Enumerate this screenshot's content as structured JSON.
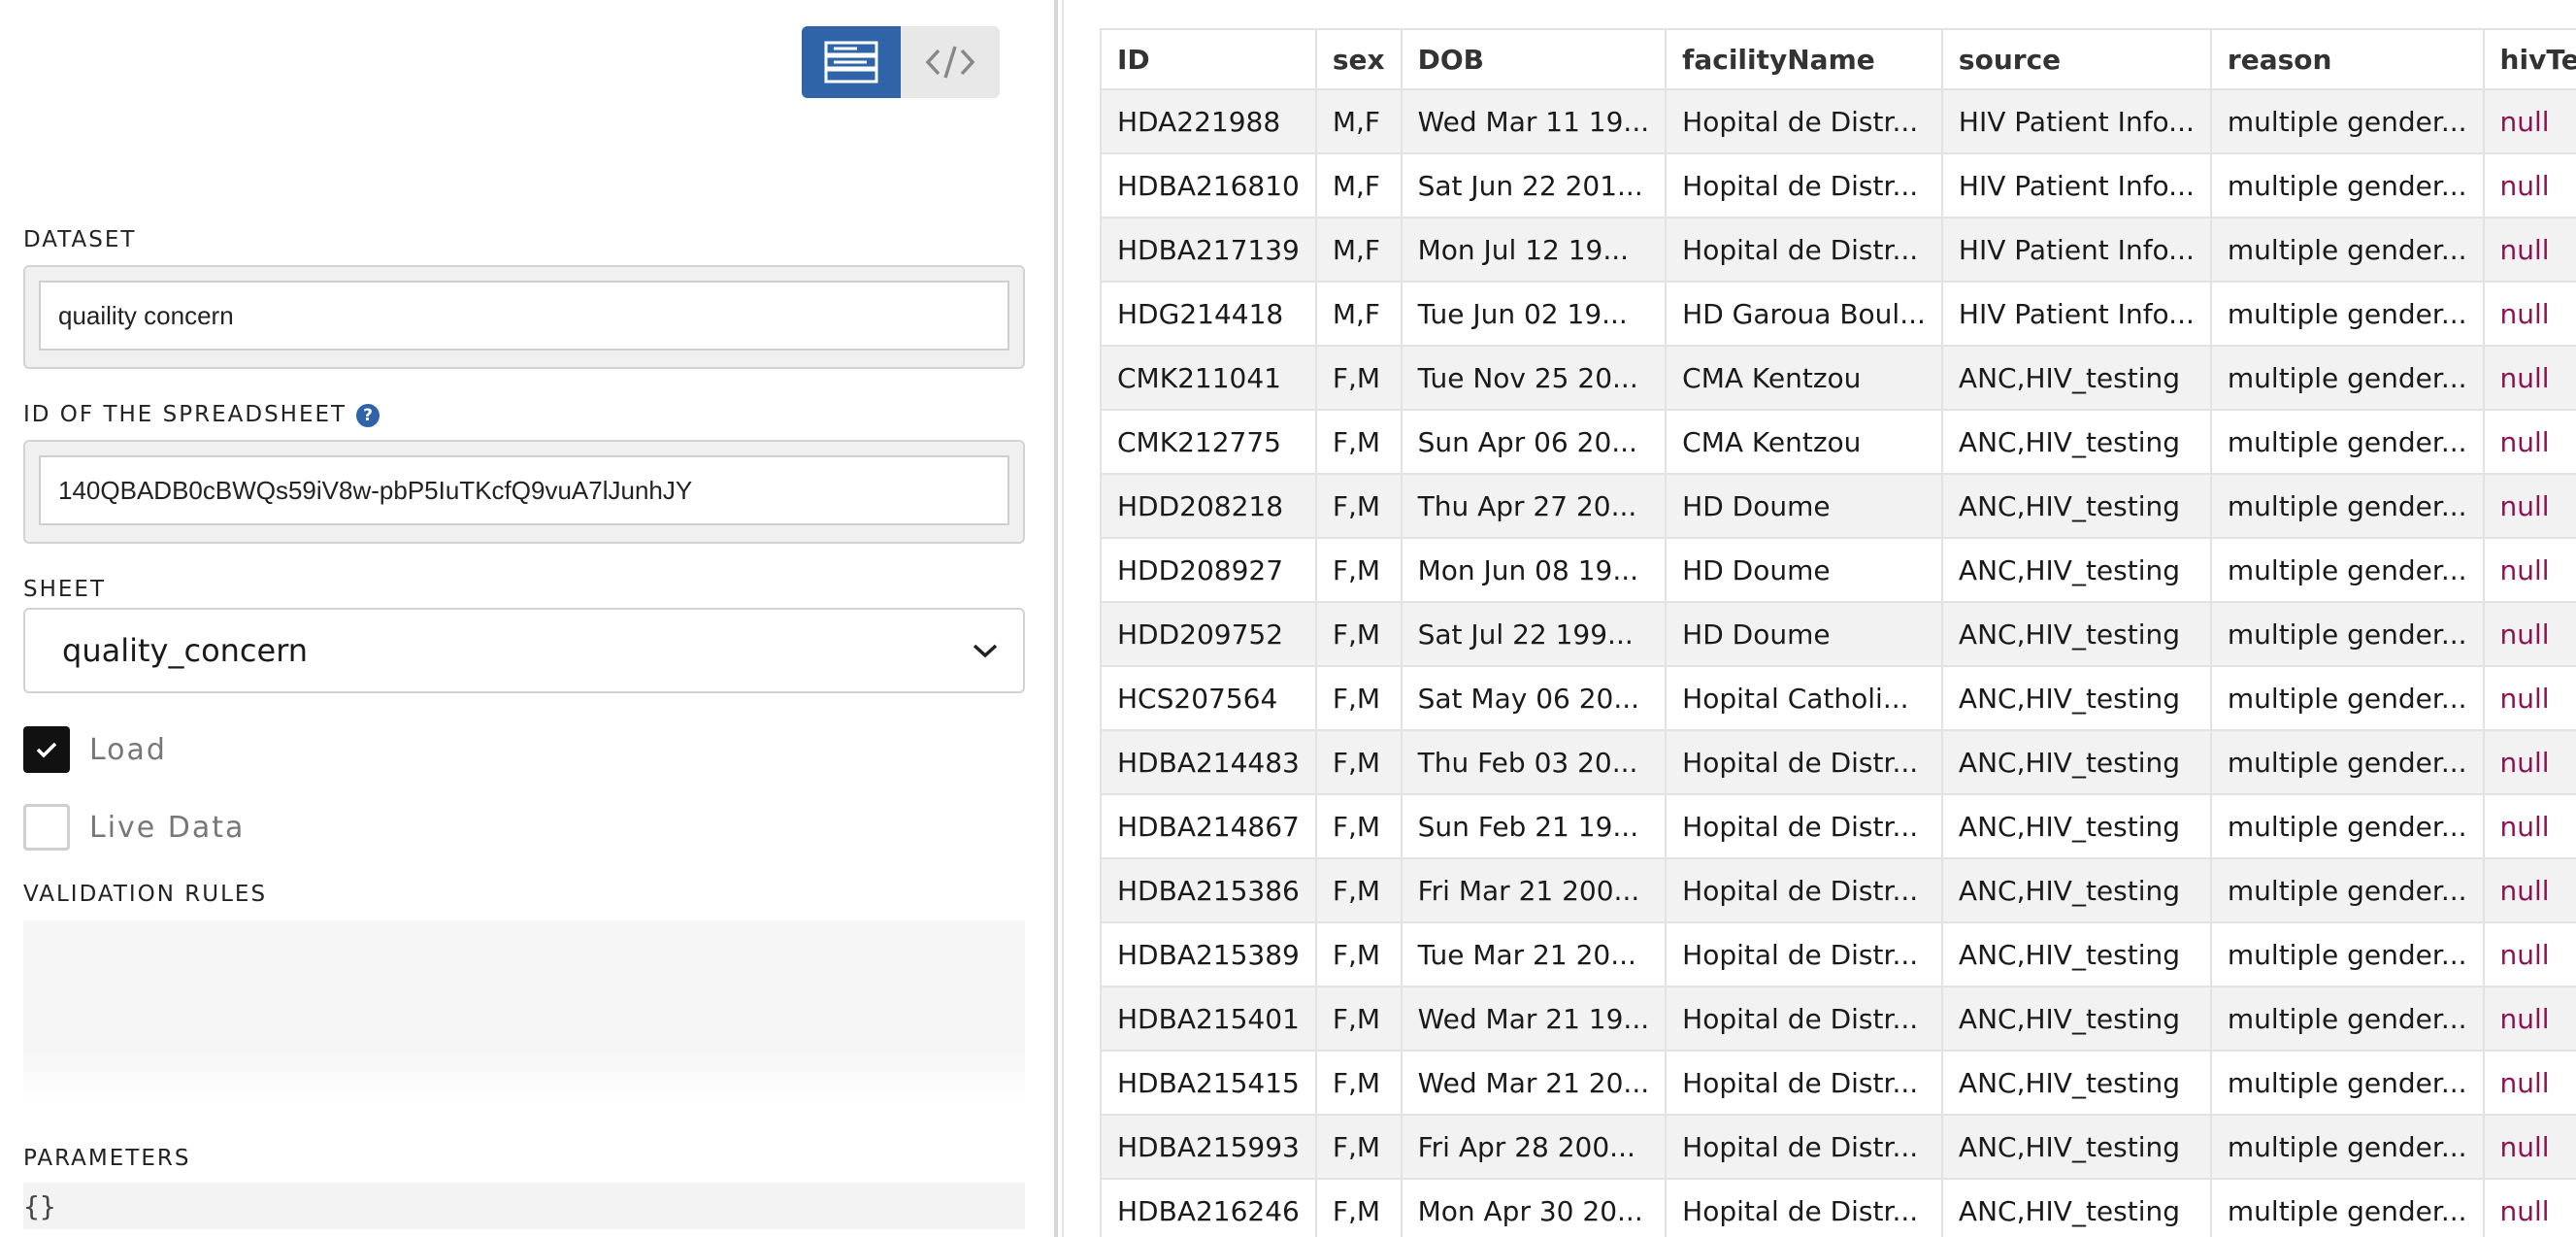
{
  "left": {
    "dataset": {
      "label": "DATASET",
      "value": "quaility concern"
    },
    "spreadsheet": {
      "label": "ID OF THE SPREADSHEET",
      "value": "140QBADB0cBWQs59iV8w-pbP5IuTKcfQ9vuA7lJunhJY"
    },
    "sheet": {
      "label": "SHEET",
      "value": "quality_concern"
    },
    "load": {
      "label": "Load",
      "checked": true
    },
    "live": {
      "label": "Live Data",
      "checked": false
    },
    "rules": {
      "label": "VALIDATION RULES"
    },
    "params": {
      "label": "PARAMETERS",
      "value": "{}"
    }
  },
  "table": {
    "columns": [
      "ID",
      "sex",
      "DOB",
      "facilityName",
      "source",
      "reason",
      "hivTes"
    ],
    "rows": [
      [
        "HDA221988",
        "M,F",
        "Wed Mar 11 19...",
        "Hopital de Distr...",
        "HIV Patient Info...",
        "multiple gender...",
        "null"
      ],
      [
        "HDBA216810",
        "M,F",
        "Sat Jun 22 201...",
        "Hopital de Distr...",
        "HIV Patient Info...",
        "multiple gender...",
        "null"
      ],
      [
        "HDBA217139",
        "M,F",
        "Mon Jul 12 19...",
        "Hopital de Distr...",
        "HIV Patient Info...",
        "multiple gender...",
        "null"
      ],
      [
        "HDG214418",
        "M,F",
        "Tue Jun 02 19...",
        "HD Garoua Boul...",
        "HIV Patient Info...",
        "multiple gender...",
        "null"
      ],
      [
        "CMK211041",
        "F,M",
        "Tue Nov 25 20...",
        "CMA Kentzou",
        "ANC,HIV_testing",
        "multiple gender...",
        "null"
      ],
      [
        "CMK212775",
        "F,M",
        "Sun Apr 06 20...",
        "CMA Kentzou",
        "ANC,HIV_testing",
        "multiple gender...",
        "null"
      ],
      [
        "HDD208218",
        "F,M",
        "Thu Apr 27 20...",
        "HD Doume",
        "ANC,HIV_testing",
        "multiple gender...",
        "null"
      ],
      [
        "HDD208927",
        "F,M",
        "Mon Jun 08 19...",
        "HD Doume",
        "ANC,HIV_testing",
        "multiple gender...",
        "null"
      ],
      [
        "HDD209752",
        "F,M",
        "Sat Jul 22 199...",
        "HD Doume",
        "ANC,HIV_testing",
        "multiple gender...",
        "null"
      ],
      [
        "HCS207564",
        "F,M",
        "Sat May 06 20...",
        "Hopital Catholi...",
        "ANC,HIV_testing",
        "multiple gender...",
        "null"
      ],
      [
        "HDBA214483",
        "F,M",
        "Thu Feb 03 20...",
        "Hopital de Distr...",
        "ANC,HIV_testing",
        "multiple gender...",
        "null"
      ],
      [
        "HDBA214867",
        "F,M",
        "Sun Feb 21 19...",
        "Hopital de Distr...",
        "ANC,HIV_testing",
        "multiple gender...",
        "null"
      ],
      [
        "HDBA215386",
        "F,M",
        "Fri Mar 21 200...",
        "Hopital de Distr...",
        "ANC,HIV_testing",
        "multiple gender...",
        "null"
      ],
      [
        "HDBA215389",
        "F,M",
        "Tue Mar 21 20...",
        "Hopital de Distr...",
        "ANC,HIV_testing",
        "multiple gender...",
        "null"
      ],
      [
        "HDBA215401",
        "F,M",
        "Wed Mar 21 19...",
        "Hopital de Distr...",
        "ANC,HIV_testing",
        "multiple gender...",
        "null"
      ],
      [
        "HDBA215415",
        "F,M",
        "Wed Mar 21 20...",
        "Hopital de Distr...",
        "ANC,HIV_testing",
        "multiple gender...",
        "null"
      ],
      [
        "HDBA215993",
        "F,M",
        "Fri Apr 28 200...",
        "Hopital de Distr...",
        "ANC,HIV_testing",
        "multiple gender...",
        "null"
      ],
      [
        "HDBA216246",
        "F,M",
        "Mon Apr 30 20...",
        "Hopital de Distr...",
        "ANC,HIV_testing",
        "multiple gender...",
        "null"
      ]
    ]
  }
}
